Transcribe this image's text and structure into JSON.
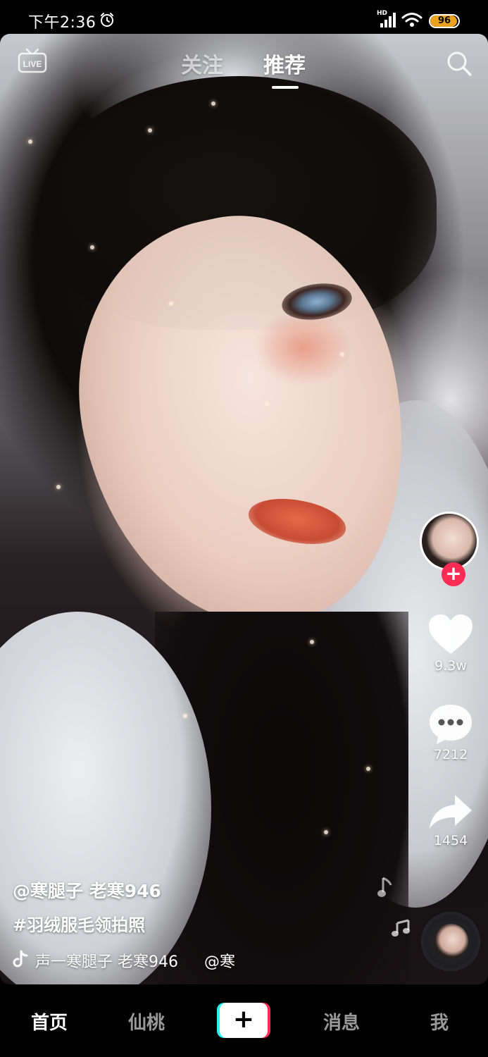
{
  "status_bar": {
    "time": "下午2:36",
    "network_label": "HD",
    "battery_level": "96",
    "battery_fraction": 0.96
  },
  "top_nav": {
    "live_label": "LIVE",
    "tabs": [
      {
        "label": "关注",
        "active": false
      },
      {
        "label": "推荐",
        "active": true
      }
    ]
  },
  "actions": {
    "likes": "9.3w",
    "comments": "7212",
    "shares": "1454"
  },
  "caption": {
    "author": "@寒腿子 老寒946",
    "hashtag": "#羽绒服毛领拍照",
    "sound": "声一寒腿子 老寒946",
    "sound_mention": "@寒"
  },
  "bottom_nav": {
    "items": [
      {
        "label": "首页",
        "active": true
      },
      {
        "label": "仙桃",
        "active": false
      },
      {
        "label": "+",
        "active": false
      },
      {
        "label": "消息",
        "active": false
      },
      {
        "label": "我",
        "active": false
      }
    ]
  },
  "colors": {
    "accent": "#fe2c55",
    "accent_cyan": "#25f4ee",
    "battery": "#e8a21f"
  }
}
